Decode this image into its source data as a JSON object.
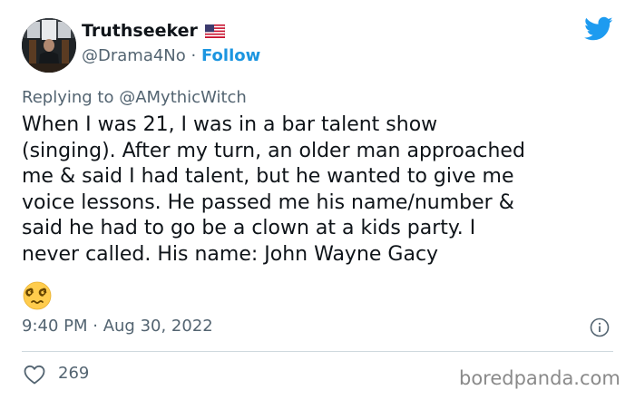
{
  "author": {
    "display_name": "Truthseeker",
    "flag_icon": "us-flag-icon",
    "handle": "@Drama4No",
    "separator": " · ",
    "follow_label": "Follow"
  },
  "reply": {
    "prefix": "Replying to ",
    "target": "@AMythicWitch"
  },
  "body_lines": [
    "When I was 21, I was in a bar talent show",
    "(singing). After my turn, an older man approached",
    "me & said I had talent, but he wanted to give me",
    "voice lessons. He passed me his name/number &",
    "said he had to go be a clown at a kids party. I",
    "never called. His name: John Wayne Gacy"
  ],
  "emoji": "dizzy-face-emoji",
  "meta": {
    "time": "9:40 PM",
    "separator": " · ",
    "date": "Aug 30, 2022"
  },
  "likes": "269",
  "watermark": "boredpanda.com",
  "colors": {
    "twitter_blue": "#1d9bf0",
    "follow_blue": "#1b95e0",
    "secondary_text": "#536471",
    "primary_text": "#0f1419",
    "divider": "#cfd9de"
  },
  "icons": [
    "twitter-bird-icon",
    "info-icon",
    "heart-icon"
  ]
}
